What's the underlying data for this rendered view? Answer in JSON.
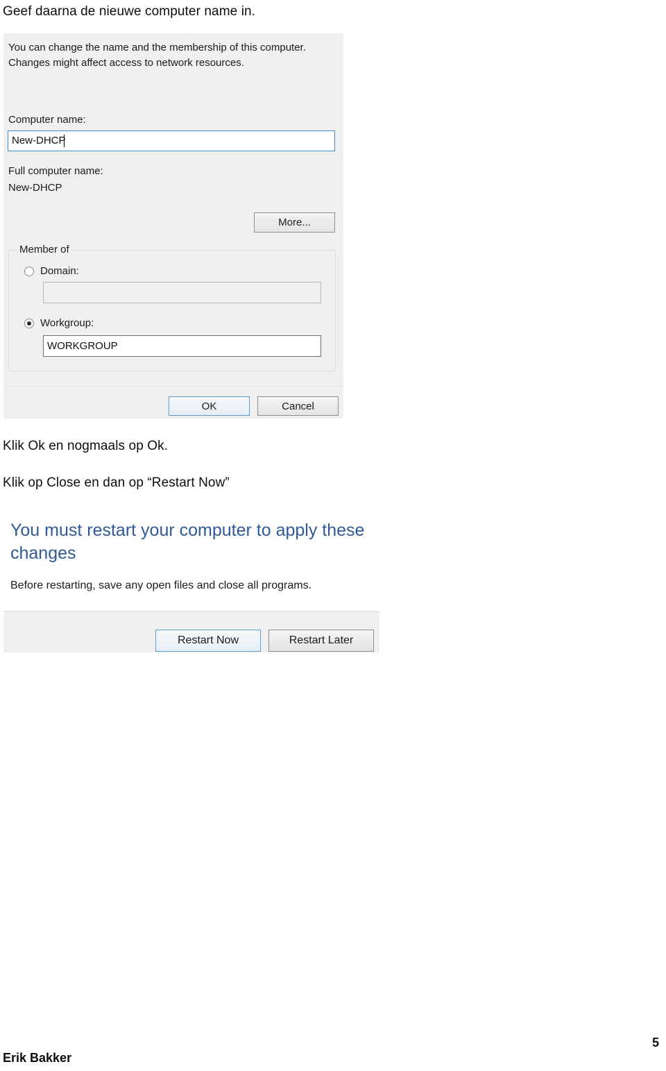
{
  "document": {
    "intro_line": "Geef daarna de nieuwe computer name in.",
    "klik_ok_line": "Klik Ok en nogmaals op Ok.",
    "klik_close_line": "Klik op Close en dan op “Restart Now”",
    "footer_author": "Erik Bakker",
    "footer_page_number": "5"
  },
  "system_properties_dialog": {
    "description": "You can change the name and the membership of this computer. Changes might affect access to network resources.",
    "computer_name_label": "Computer name:",
    "computer_name_value": "New-DHCP",
    "full_computer_name_label": "Full computer name:",
    "full_computer_name_value": "New-DHCP",
    "more_button": "More...",
    "member_of": {
      "group_label": "Member of",
      "domain_radio_label": "Domain:",
      "domain_selected": false,
      "domain_value": "",
      "workgroup_radio_label": "Workgroup:",
      "workgroup_selected": true,
      "workgroup_value": "WORKGROUP"
    },
    "ok_button": "OK",
    "cancel_button": "Cancel",
    "colors": {
      "dialog_background": "#f0f0f0",
      "focus_border": "#3b8bd1",
      "default_button_border": "#5a9fd4"
    }
  },
  "restart_dialog": {
    "heading": "You must restart your computer to apply these changes",
    "subtext": "Before restarting, save any open files and close all programs.",
    "restart_now_button": "Restart Now",
    "restart_later_button": "Restart Later",
    "colors": {
      "heading_color": "#2f5a96",
      "body_background": "#ffffff",
      "footer_background": "#f0f0f0"
    }
  }
}
